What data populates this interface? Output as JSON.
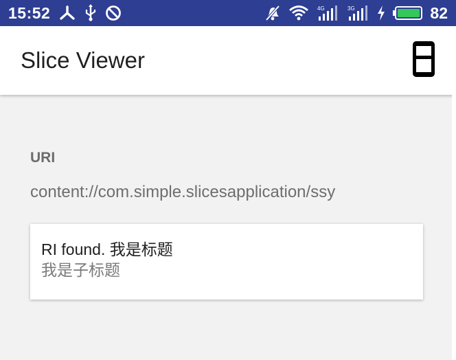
{
  "status_bar": {
    "time": "15:52",
    "battery_percent": "82",
    "left_icons": [
      "share-nodes-icon",
      "usb-icon",
      "do-not-disturb-icon"
    ],
    "right_icons": [
      "muted-bell-icon",
      "wifi-icon",
      "signal-4g-icon",
      "signal-3g-icon",
      "charging-icon",
      "battery-icon"
    ],
    "signal_4g_label": "4G",
    "signal_3g_label": "3G",
    "background_color": "#2e3e92"
  },
  "app_bar": {
    "title": "Slice Viewer",
    "mode_button_icon": "phone-slice-mode-icon"
  },
  "content": {
    "uri_label": "URI",
    "uri_value": "content://com.simple.slicesapplication/ssy",
    "slice": {
      "title": "RI found. 我是标题",
      "subtitle": "我是子标题"
    }
  }
}
